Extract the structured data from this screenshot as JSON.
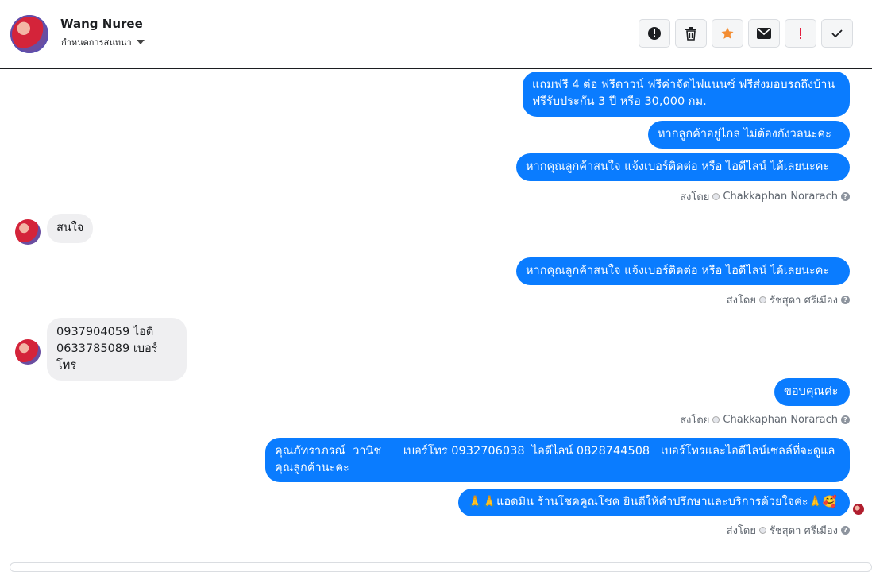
{
  "header": {
    "contact_name": "Wang Nuree",
    "assign_label": "กำหนดการสนทนา",
    "actions": [
      {
        "name": "report-icon",
        "color": "#1c1e21"
      },
      {
        "name": "trash-icon",
        "color": "#1c1e21"
      },
      {
        "name": "star-icon",
        "color": "#f38d32"
      },
      {
        "name": "mail-icon",
        "color": "#1c1e21"
      },
      {
        "name": "important-icon",
        "color": "#e41e3f"
      },
      {
        "name": "check-icon",
        "color": "#1c1e21"
      }
    ]
  },
  "messages": {
    "m1": "แถมฟรี 4 ต่อ ฟรีดาวน์ ฟรีค่าจัดไฟแนนซ์ ฟรีส่งมอบรถถึงบ้าน\nฟรีรับประกัน 3 ปี หรือ 30,000 กม.",
    "m2": "หากลูกค้าอยู่ไกล ไม่ต้องกังวลนะคะ",
    "m3": "หากคุณลูกค้าสนใจ แจ้งเบอร์ติดต่อ หรือ ไอดีไลน์ ได้เลยนะคะ",
    "sent1_prefix": "ส่งโดย",
    "sent1_name": "Chakkaphan Norarach",
    "in1": "สนใจ",
    "m4": "หากคุณลูกค้าสนใจ แจ้งเบอร์ติดต่อ หรือ ไอดีไลน์ ได้เลยนะคะ",
    "sent2_prefix": "ส่งโดย",
    "sent2_name": "รัชสุดา ศรีเมือง",
    "in2": "0937904059 ไอดี\n0633785089 เบอร์โทร",
    "m5": "ขอบคุณค่ะ",
    "sent3_prefix": "ส่งโดย",
    "sent3_name": "Chakkaphan Norarach",
    "m6": "คุณภัทราภรณ์  วานิช      เบอร์โทร 0932706038  ไอดีไลน์ 0828744508   เบอร์โทรและไอดีไลน์เซลล์ที่จะดูแล\nคุณลูกค้านะคะ",
    "m7": "🙏🙏แอดมิน ร้านโชคคูณโชค ยินดีให้คำปรึกษาและบริการด้วยใจค่ะ🙏🥰",
    "sent4_prefix": "ส่งโดย",
    "sent4_name": "รัชสุดา ศรีเมือง"
  }
}
